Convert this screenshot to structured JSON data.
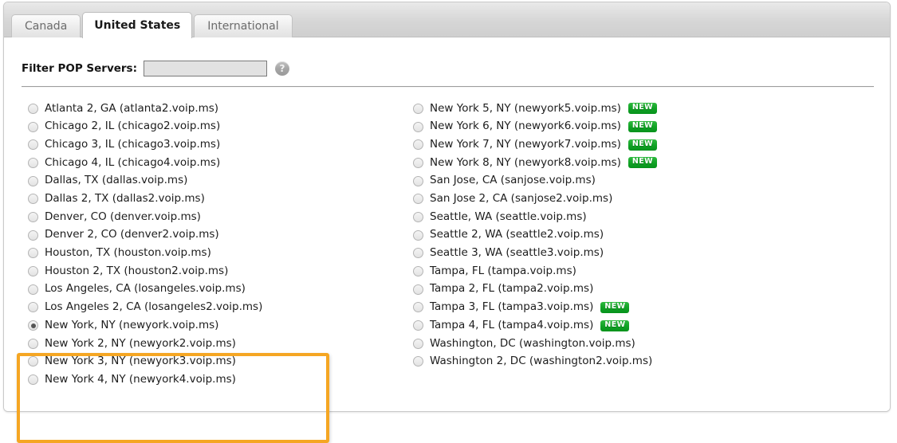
{
  "window": {
    "tabs": [
      {
        "label": "Canada",
        "active": false
      },
      {
        "label": "United States",
        "active": true
      },
      {
        "label": "International",
        "active": false
      }
    ]
  },
  "filter": {
    "label": "Filter POP Servers:",
    "value": "",
    "placeholder": "",
    "help_icon": "help-question-icon",
    "help_glyph": "?"
  },
  "colors": {
    "highlight_border": "#f5a623",
    "new_badge": "#12a326",
    "active_tab_bg": "#ffffff",
    "tab_strip_bg": "#d6d6d6"
  },
  "servers": {
    "left_column": [
      {
        "label": "Atlanta 2, GA (atlanta2.voip.ms)",
        "selected": false,
        "badge": ""
      },
      {
        "label": "Chicago 2, IL (chicago2.voip.ms)",
        "selected": false,
        "badge": ""
      },
      {
        "label": "Chicago 3, IL (chicago3.voip.ms)",
        "selected": false,
        "badge": ""
      },
      {
        "label": "Chicago 4, IL (chicago4.voip.ms)",
        "selected": false,
        "badge": ""
      },
      {
        "label": "Dallas, TX (dallas.voip.ms)",
        "selected": false,
        "badge": ""
      },
      {
        "label": "Dallas 2, TX (dallas2.voip.ms)",
        "selected": false,
        "badge": ""
      },
      {
        "label": "Denver, CO (denver.voip.ms)",
        "selected": false,
        "badge": ""
      },
      {
        "label": "Denver 2, CO (denver2.voip.ms)",
        "selected": false,
        "badge": ""
      },
      {
        "label": "Houston, TX (houston.voip.ms)",
        "selected": false,
        "badge": ""
      },
      {
        "label": "Houston 2, TX (houston2.voip.ms)",
        "selected": false,
        "badge": ""
      },
      {
        "label": "Los Angeles, CA (losangeles.voip.ms)",
        "selected": false,
        "badge": ""
      },
      {
        "label": "Los Angeles 2, CA (losangeles2.voip.ms)",
        "selected": false,
        "badge": ""
      },
      {
        "label": "New York, NY (newyork.voip.ms)",
        "selected": true,
        "badge": ""
      },
      {
        "label": "New York 2, NY (newyork2.voip.ms)",
        "selected": false,
        "badge": ""
      },
      {
        "label": "New York 3, NY (newyork3.voip.ms)",
        "selected": false,
        "badge": ""
      },
      {
        "label": "New York 4, NY (newyork4.voip.ms)",
        "selected": false,
        "badge": ""
      }
    ],
    "right_column": [
      {
        "label": "New York 5, NY (newyork5.voip.ms)",
        "selected": false,
        "badge": "NEW"
      },
      {
        "label": "New York 6, NY (newyork6.voip.ms)",
        "selected": false,
        "badge": "NEW"
      },
      {
        "label": "New York 7, NY (newyork7.voip.ms)",
        "selected": false,
        "badge": "NEW"
      },
      {
        "label": "New York 8, NY (newyork8.voip.ms)",
        "selected": false,
        "badge": "NEW"
      },
      {
        "label": "San Jose, CA (sanjose.voip.ms)",
        "selected": false,
        "badge": ""
      },
      {
        "label": "San Jose 2, CA (sanjose2.voip.ms)",
        "selected": false,
        "badge": ""
      },
      {
        "label": "Seattle, WA (seattle.voip.ms)",
        "selected": false,
        "badge": ""
      },
      {
        "label": "Seattle 2, WA (seattle2.voip.ms)",
        "selected": false,
        "badge": ""
      },
      {
        "label": "Seattle 3, WA (seattle3.voip.ms)",
        "selected": false,
        "badge": ""
      },
      {
        "label": "Tampa, FL (tampa.voip.ms)",
        "selected": false,
        "badge": ""
      },
      {
        "label": "Tampa 2, FL (tampa2.voip.ms)",
        "selected": false,
        "badge": ""
      },
      {
        "label": "Tampa 3, FL (tampa3.voip.ms)",
        "selected": false,
        "badge": "NEW"
      },
      {
        "label": "Tampa 4, FL (tampa4.voip.ms)",
        "selected": false,
        "badge": "NEW"
      },
      {
        "label": "Washington, DC (washington.voip.ms)",
        "selected": false,
        "badge": ""
      },
      {
        "label": "Washington 2, DC (washington2.voip.ms)",
        "selected": false,
        "badge": ""
      }
    ]
  }
}
